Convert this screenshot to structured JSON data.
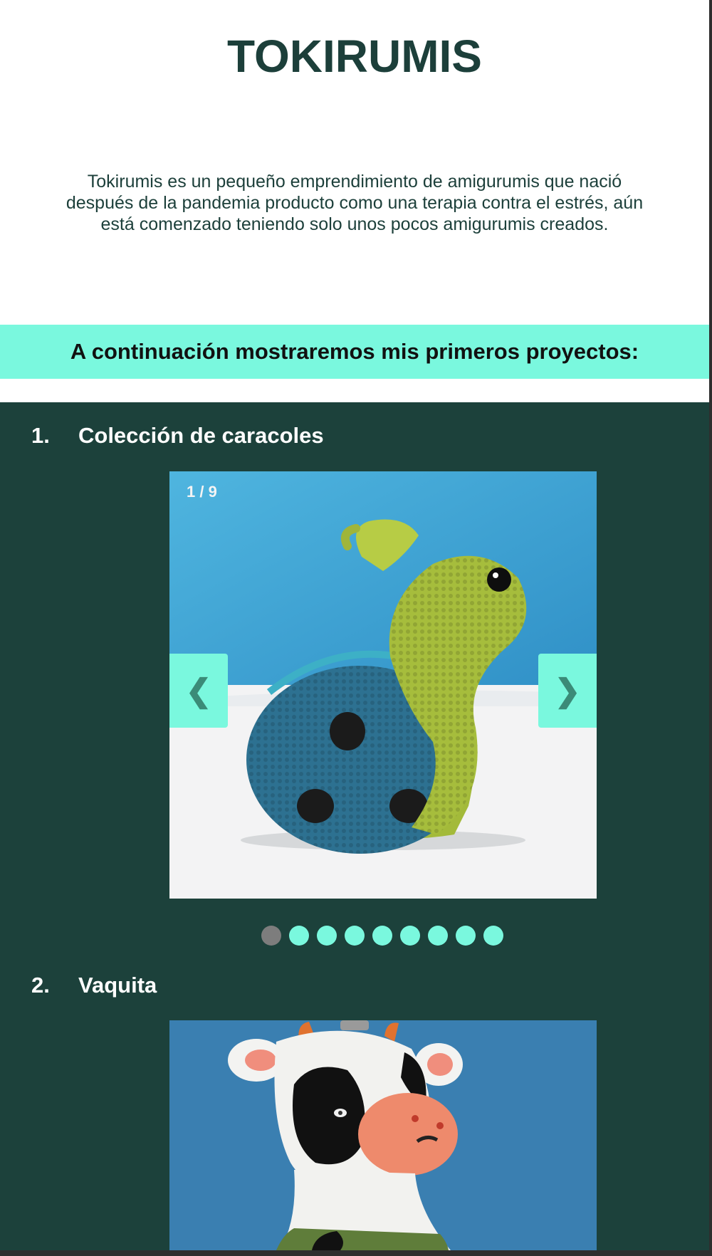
{
  "site": {
    "title": "TOKIRUMIS",
    "intro": "Tokirumis es un pequeño emprendimiento de amigurumis que nació después de la pandemia producto como una terapia contra el estrés, aún está comenzado teniendo solo unos pocos amigurumis creados."
  },
  "banner": {
    "text": "A continuación mostraremos mis primeros proyectos:"
  },
  "projects": [
    {
      "number": "1.",
      "title": "Colección de caracoles",
      "counter": "1 / 9",
      "prev_icon": "❮",
      "next_icon": "❯",
      "slide_count": 9,
      "active_slide": 1
    },
    {
      "number": "2.",
      "title": "Vaquita"
    }
  ],
  "colors": {
    "brand_dark": "#1c413b",
    "accent": "#7af8de",
    "title": "#1c3f3a",
    "dot_active": "#7d7d7d"
  }
}
